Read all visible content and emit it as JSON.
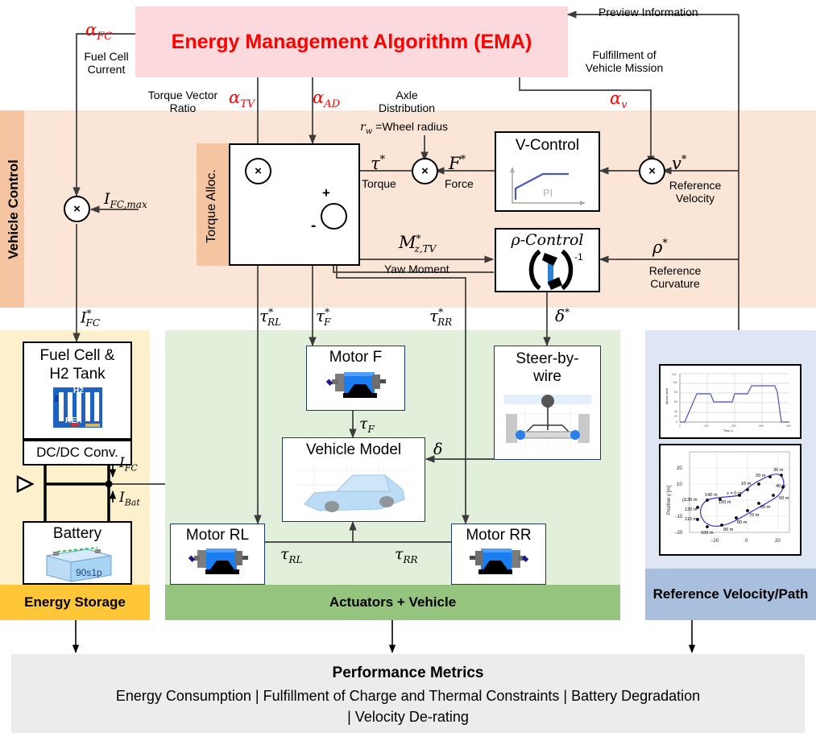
{
  "header": {
    "ema_title": "Energy Management Algorithm (EMA)",
    "ema_color": "#ff0000",
    "ema_bg": "#fbd9dc"
  },
  "bands": {
    "vehicle_control": {
      "label": "Vehicle Control",
      "tab_color": "#f4c5a0",
      "bg_color": "#fbe5d6"
    },
    "energy_storage": {
      "label": "Energy Storage",
      "footer_color": "#ffc738",
      "bg_color": "#fdf0cd"
    },
    "actuators": {
      "label": "Actuators + Vehicle",
      "footer_color": "#94c47d",
      "bg_color": "#e2efda"
    },
    "reference": {
      "label": "Reference Velocity/Path",
      "footer_color": "#a8bfdd",
      "bg_color": "#dde6f2"
    },
    "torque_alloc": {
      "label": "Torque Alloc.",
      "tab_color": "#f4c5a0"
    }
  },
  "signals": {
    "alpha_fc": "α_FC",
    "alpha_fc_caption": "Fuel Cell\nCurrent",
    "alpha_tv": "α_TV",
    "alpha_tv_caption": "Torque Vector\nRatio",
    "alpha_ad": "α_AD",
    "alpha_ad_caption": "Axle\nDistribution",
    "alpha_v": "α_v",
    "preview_information": "Preview Information",
    "fulfillment_of_vehicle_mission": "Fulfillment of\nVehicle Mission",
    "i_fc_max": "I_FC,max",
    "i_fc_star": "I*_FC",
    "i_fc": "I_FC",
    "i_bat": "I_Bat",
    "rw_note": "r_w =Wheel radius",
    "tau_star": "τ*",
    "tau_star_caption": "Torque",
    "f_star": "F*",
    "f_star_caption": "Force",
    "v_star": "v*",
    "v_star_caption": "Reference\nVelocity",
    "rho_star": "ρ*",
    "rho_star_caption": "Reference\nCurvature",
    "mz_tv": "M*_z,TV",
    "mz_tv_caption": "Yaw Moment",
    "tau_rl_star": "τ*_RL",
    "tau_f_star": "τ*_F",
    "tau_rr_star": "τ*_RR",
    "delta_star": "δ*",
    "tau_f": "τ_F",
    "tau_rl": "τ_RL",
    "tau_rr": "τ_RR",
    "delta": "δ",
    "plus": "+",
    "minus": "-",
    "multiply": "×"
  },
  "blocks": {
    "v_control": {
      "title": "V-Control",
      "icon_label": "PI"
    },
    "rho_control": {
      "title": "ρ-Control",
      "icon_exponent": "-1"
    },
    "fuel_cell": {
      "title": "Fuel Cell &\nH2 Tank",
      "icon_top_label": "H2",
      "icon_bottom_label": "REX",
      "subtitle": "DC/DC Conv."
    },
    "battery": {
      "title": "Battery",
      "icon_label": "90s1p"
    },
    "motor_f": {
      "title": "Motor F"
    },
    "motor_rl": {
      "title": "Motor RL"
    },
    "motor_rr": {
      "title": "Motor RR"
    },
    "vehicle_model": {
      "title": "Vehicle Model"
    },
    "steer_by_wire": {
      "title": "Steer-by-\nwire"
    }
  },
  "performance": {
    "title": "Performance Metrics",
    "line1": "Energy Consumption | Fulfillment of Charge and Thermal Constraints | Battery Degradation",
    "line2": "| Velocity De-rating",
    "bg_color": "#ececec"
  },
  "chart_data": [
    {
      "type": "line",
      "name": "reference-velocity-profile",
      "title": "",
      "xlabel": "Time, s",
      "ylabel": "Speed, km/h",
      "xlim": [
        0,
        400
      ],
      "ylim": [
        0,
        120
      ],
      "xticks": [
        0,
        100,
        200,
        300,
        400
      ],
      "yticks": [
        0,
        20,
        40,
        60,
        80,
        100,
        120
      ],
      "grid": true,
      "line_color": "#4a56b5",
      "x": [
        0,
        18,
        62,
        110,
        122,
        190,
        200,
        248,
        262,
        278,
        345,
        355,
        372,
        400
      ],
      "y": [
        0,
        0,
        70,
        70,
        50,
        50,
        70,
        70,
        90,
        90,
        90,
        75,
        0,
        0
      ]
    },
    {
      "type": "scatter",
      "name": "reference-path-figure-eight",
      "title": "",
      "xlabel": "",
      "ylabel": "Position y [m]",
      "xlim": [
        -35,
        30
      ],
      "ylim": [
        -25,
        25
      ],
      "xticks": [
        -20,
        0,
        20
      ],
      "yticks": [
        -20,
        -10,
        0,
        10,
        20
      ],
      "grid": true,
      "line_color": "#3333cc",
      "marker_color": "#000000",
      "annotations": [
        "s = 0 m",
        "10 m",
        "20 m",
        "30 m",
        "40 m",
        "50 m",
        "60 m",
        "70 m",
        "80 m",
        "90 m",
        "100 m",
        "110 m",
        "120 m",
        "130 m",
        "140 m",
        "150 m"
      ],
      "points": [
        {
          "label": "s = 0 m",
          "x": -5.5,
          "y": 3.0
        },
        {
          "label": "10 m",
          "x": 2.0,
          "y": 6.5
        },
        {
          "label": "20 m",
          "x": 9.5,
          "y": 10.0
        },
        {
          "label": "30 m",
          "x": 16.5,
          "y": 17.5
        },
        {
          "label": "40 m",
          "x": 24.5,
          "y": 19.0
        },
        {
          "label": "50 m",
          "x": 26.5,
          "y": 9.5
        },
        {
          "label": "60 m",
          "x": 20.0,
          "y": 3.0
        },
        {
          "label": "70 m",
          "x": 9.5,
          "y": -2.5
        },
        {
          "label": "80 m",
          "x": 2.0,
          "y": -8.0
        },
        {
          "label": "90 m",
          "x": -5.0,
          "y": -14.0
        },
        {
          "label": "100 m",
          "x": -14.0,
          "y": -19.5
        },
        {
          "label": "110 m",
          "x": -23.0,
          "y": -21.5
        },
        {
          "label": "120 m",
          "x": -30.5,
          "y": -15.5
        },
        {
          "label": "130 m",
          "x": -31.0,
          "y": -6.0
        },
        {
          "label": "140 m",
          "x": -23.0,
          "y": -0.5
        },
        {
          "label": "150 m",
          "x": -13.5,
          "y": 0.0
        }
      ]
    }
  ]
}
